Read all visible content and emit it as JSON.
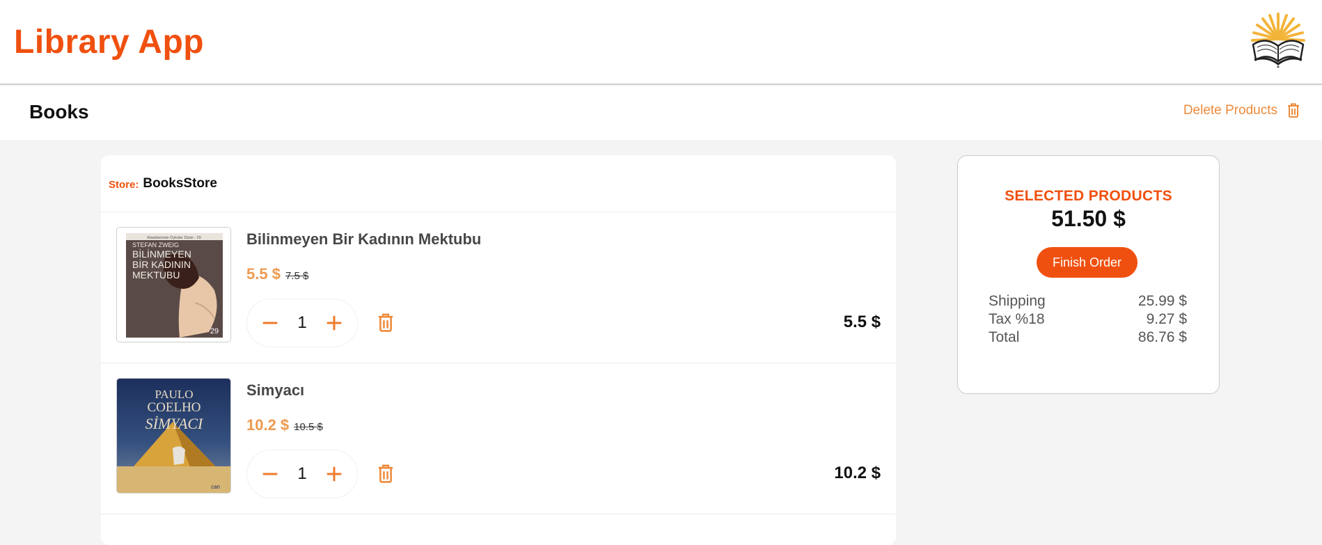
{
  "header": {
    "app_title": "Library App"
  },
  "subheader": {
    "title": "Books",
    "delete_label": "Delete Products"
  },
  "cart": {
    "store_label": "Store:",
    "store_name": "BooksStore",
    "items": [
      {
        "title": "Bilinmeyen Bir Kadının Mektubu",
        "price": "5.5 $",
        "old_price": "7.5 $",
        "quantity": "1",
        "line_total": "5.5 $",
        "cover": {
          "series": "Klasiklerinde Öyküler Dizisi - 29",
          "author": "STEFAN ZWEIG",
          "title_line1": "BİLİNMEYEN",
          "title_line2": "BİR KADININ",
          "title_line3": "MEKTUBU",
          "badge": "29"
        }
      },
      {
        "title": "Simyacı",
        "price": "10.2 $",
        "old_price": "10.5 $",
        "quantity": "1",
        "line_total": "10.2 $",
        "cover": {
          "author_line1": "PAULO",
          "author_line2": "COELHO",
          "title": "SİMYACI",
          "publisher": "can"
        }
      }
    ]
  },
  "summary": {
    "label": "SELECTED PRODUCTS",
    "value": "51.50 $",
    "finish_label": "Finish Order",
    "fees": [
      {
        "label": "Shipping",
        "value": "25.99 $"
      },
      {
        "label": "Tax %18",
        "value": "9.27 $"
      },
      {
        "label": "Total",
        "value": "86.76 $"
      }
    ]
  },
  "colors": {
    "accent": "#f0500f",
    "price": "#ee9a50",
    "icon": "#ee8a3a"
  },
  "icons": [
    "logo-icon",
    "trash-icon",
    "minus-icon",
    "plus-icon"
  ]
}
